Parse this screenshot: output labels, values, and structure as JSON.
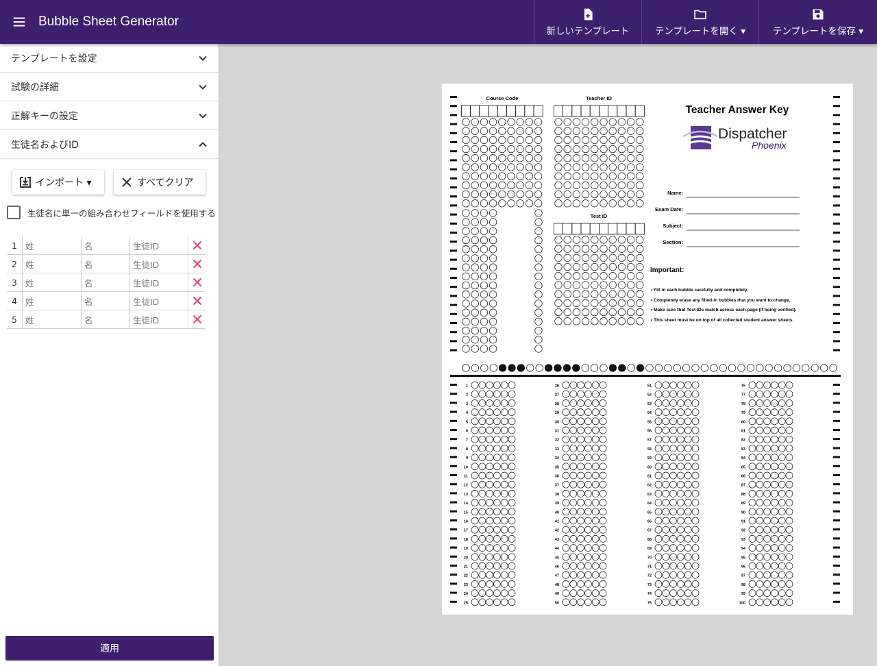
{
  "app": {
    "title": "Bubble Sheet Generator"
  },
  "toolbar": {
    "new_template": "新しいテンプレート",
    "open_template": "テンプレートを開く ▾",
    "save_template": "テンプレートを保存 ▾"
  },
  "sidebar": {
    "sections": [
      "テンプレートを設定",
      "試験の詳細",
      "正解キーの設定",
      "生徒名およびID"
    ],
    "import_label": "インポート ▾",
    "clear_label": "すべてクリア",
    "single_field_label": "生徒名に単一の組み合わせフィールドを使用する",
    "rows": [
      {
        "num": "1",
        "last": "姓",
        "first": "名",
        "id": "生徒ID"
      },
      {
        "num": "2",
        "last": "姓",
        "first": "名",
        "id": "生徒ID"
      },
      {
        "num": "3",
        "last": "姓",
        "first": "名",
        "id": "生徒ID"
      },
      {
        "num": "4",
        "last": "姓",
        "first": "名",
        "id": "生徒ID"
      },
      {
        "num": "5",
        "last": "姓",
        "first": "名",
        "id": "生徒ID"
      }
    ],
    "apply_label": "適用"
  },
  "sheet": {
    "course_code_label": "Course Code",
    "teacher_id_label": "Teacher ID",
    "test_id_label": "Test ID",
    "title": "Teacher Answer Key",
    "logo_main": "Dispatcher",
    "logo_sub": "Phoenix",
    "name_label": "Name:",
    "exam_date_label": "Exam Date:",
    "subject_label": "Subject:",
    "section_label": "Section:",
    "important_label": "Important:",
    "notes": [
      "• Fill in each bubble carefully and completely.",
      "• Completely erase any filled-in bubbles that you want to change.",
      "• Make sure that Test IDs match across each page (if being verified).",
      "• This sheet must be on top of all collected student answer sheets."
    ],
    "questions": 100,
    "choices_per_question": 6,
    "code_bubbles_filled": [
      4,
      5,
      6,
      9,
      10,
      11,
      12,
      16,
      17,
      19
    ]
  },
  "colors": {
    "primary": "#3d1f6e",
    "delete": "#e0457b"
  }
}
